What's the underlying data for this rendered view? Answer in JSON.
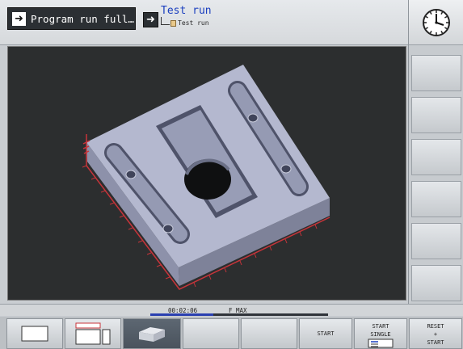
{
  "header": {
    "machine_mode": "Program run full…",
    "programming_mode": "Test run",
    "sub_mode": "Test run"
  },
  "status": {
    "time": "00:02:06",
    "feed": "F MAX",
    "progress": 0.36
  },
  "softkeys": [
    {
      "label": "",
      "icon": "single-window-icon"
    },
    {
      "label": "",
      "icon": "split-view-icon"
    },
    {
      "label": "",
      "icon": "3d-block-icon",
      "active": true
    },
    {
      "label": ""
    },
    {
      "label": ""
    },
    {
      "label": "START"
    },
    {
      "label": "START SINGLE",
      "line1": "START",
      "line2": "SINGLE",
      "icon": "single-step-icon"
    },
    {
      "label": "RESET + START",
      "line1": "RESET",
      "line2": "+",
      "line3": "START"
    }
  ],
  "colors": {
    "program_name": "#1b3fbf",
    "graphic_background": "#2c2e2f",
    "workpiece": "#a9adc4",
    "axes": "#c8343a",
    "progress": "#2a3fb0"
  }
}
